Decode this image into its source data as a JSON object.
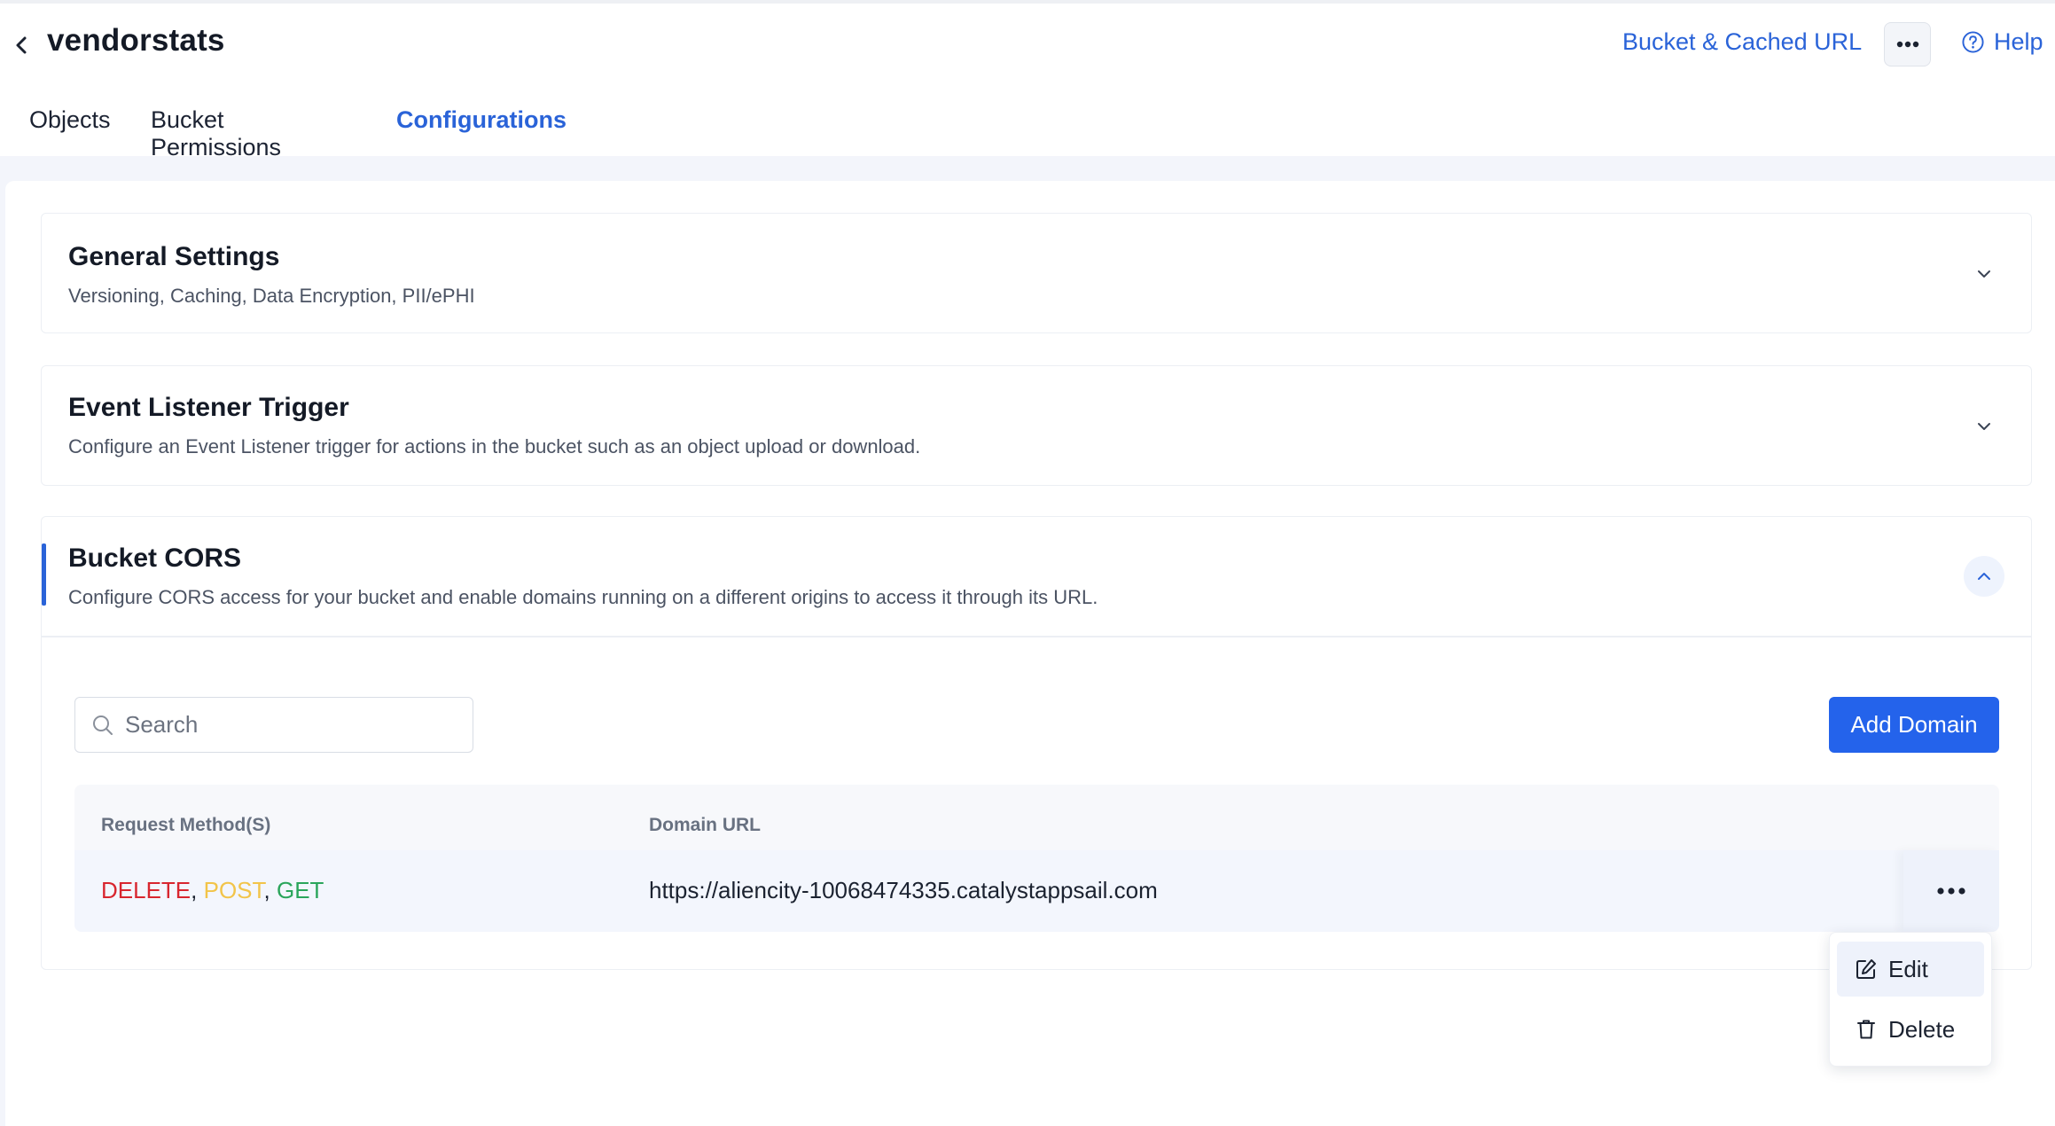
{
  "header": {
    "bucket_name": "vendorstats",
    "bucket_cached_url_label": "Bucket & Cached URL",
    "help_label": "Help"
  },
  "tabs": [
    {
      "label": "Objects",
      "active": false
    },
    {
      "label": "Bucket Permissions",
      "active": false
    },
    {
      "label": "Configurations",
      "active": true
    }
  ],
  "sections": {
    "general": {
      "title": "General Settings",
      "description": "Versioning, Caching, Data Encryption, PII/ePHI",
      "expanded": false
    },
    "event_listener": {
      "title": "Event Listener Trigger",
      "description": "Configure an Event Listener trigger for actions in the bucket such as an object upload or download.",
      "expanded": false
    },
    "cors": {
      "title": "Bucket CORS",
      "description": "Configure CORS access for your bucket and enable domains running on a different origins to access it through its URL.",
      "expanded": true
    }
  },
  "cors": {
    "search_placeholder": "Search",
    "add_domain_label": "Add Domain",
    "columns": {
      "methods": "Request Method(S)",
      "domain_url": "Domain URL"
    },
    "rows": [
      {
        "methods": [
          "DELETE",
          "POST",
          "GET"
        ],
        "domain_url": "https://aliencity-10068474335.catalystappsail.com"
      }
    ]
  },
  "context_menu": {
    "items": [
      {
        "label": "Edit",
        "icon": "edit-icon"
      },
      {
        "label": "Delete",
        "icon": "trash-icon"
      }
    ]
  },
  "colors": {
    "accent": "#2a63d8",
    "primary_button": "#2463eb",
    "method_delete": "#d8262f",
    "method_post": "#f2c449",
    "method_get": "#2aa55b"
  }
}
